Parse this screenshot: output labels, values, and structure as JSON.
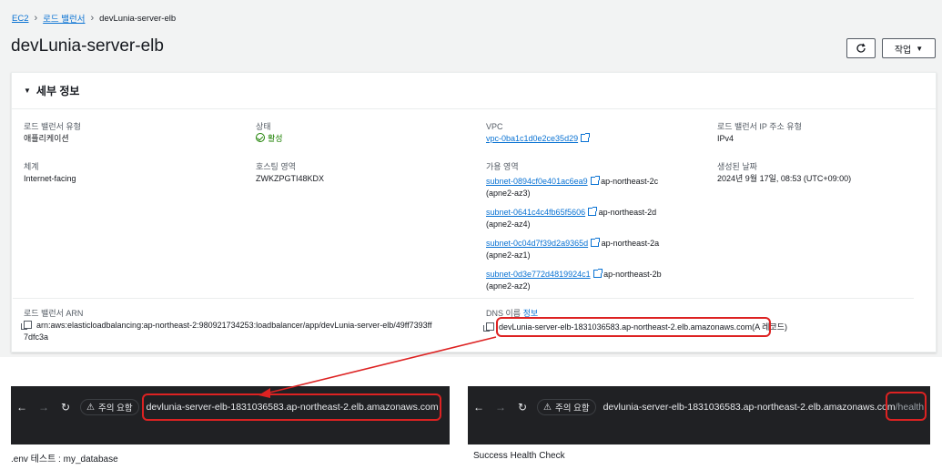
{
  "breadcrumb": {
    "items": [
      "EC2",
      "로드 밸런서"
    ],
    "current": "devLunia-server-elb"
  },
  "page": {
    "title": "devLunia-server-elb",
    "actions_label": "작업"
  },
  "panel": {
    "title": "세부 정보"
  },
  "fields": {
    "lb_type": {
      "label": "로드 밸런서 유형",
      "value": "애플리케이션"
    },
    "state": {
      "label": "상태",
      "value": "활성"
    },
    "vpc": {
      "label": "VPC",
      "value": "vpc-0ba1c1d0e2ce35d29"
    },
    "ip_type": {
      "label": "로드 밸런서 IP 주소 유형",
      "value": "IPv4"
    },
    "scheme": {
      "label": "체계",
      "value": "Internet-facing"
    },
    "hosted_zone": {
      "label": "호스팅 영역",
      "value": "ZWKZPGTI48KDX"
    },
    "az": {
      "label": "가용 영역",
      "items": [
        {
          "subnet": "subnet-0894cf0e401ac6ea9",
          "zone": "ap-northeast-2c",
          "code": "(apne2-az3)"
        },
        {
          "subnet": "subnet-0641c4c4fb65f5606",
          "zone": "ap-northeast-2d",
          "code": "(apne2-az4)"
        },
        {
          "subnet": "subnet-0c04d7f39d2a9365d",
          "zone": "ap-northeast-2a",
          "code": "(apne2-az1)"
        },
        {
          "subnet": "subnet-0d3e772d4819924c1",
          "zone": "ap-northeast-2b",
          "code": "(apne2-az2)"
        }
      ]
    },
    "created": {
      "label": "생성된 날짜",
      "value": "2024년 9월 17일, 08:53 (UTC+09:00)"
    },
    "arn": {
      "label": "로드 밸런서 ARN",
      "value_line1": "arn:aws:elasticloadbalancing:ap-northeast-2:980921734253:loadbalancer/app/devLunia-server-elb/49ff7393ff",
      "value_line2": "7dfc3a"
    },
    "dns": {
      "label": "DNS 이름",
      "info": "정보",
      "value": "devLunia-server-elb-1831036583.ap-northeast-2.elb.amazonaws.com",
      "suffix": "(A 레코드)"
    }
  },
  "browser_left": {
    "warning": "주의 요함",
    "url": "devlunia-server-elb-1831036583.ap-northeast-2.elb.amazonaws.com",
    "caption": ".env 테스트 : my_database"
  },
  "browser_right": {
    "warning": "주의 요함",
    "url": "devlunia-server-elb-1831036583.ap-northeast-2.elb.amazonaws.com",
    "path": "/health",
    "caption": "Success Health Check"
  },
  "colors": {
    "link": "#0972d3",
    "success": "#1d8102",
    "highlight": "#dd2222",
    "browser_bg": "#202124"
  },
  "icons": [
    "refresh-icon",
    "caret-down-icon",
    "external-link-icon",
    "check-circle-icon",
    "copy-icon",
    "back-arrow-icon",
    "forward-arrow-icon",
    "reload-icon",
    "warning-icon"
  ]
}
